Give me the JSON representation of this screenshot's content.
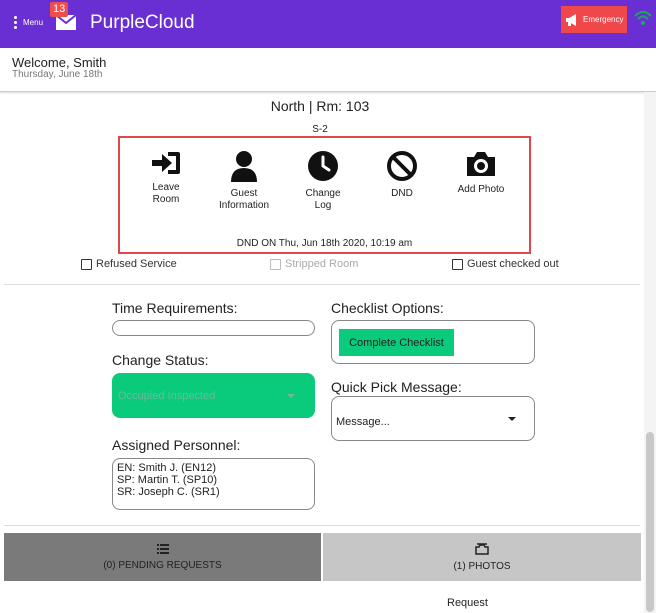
{
  "header": {
    "menu_label": "Menu",
    "mail_count": "13",
    "app_title": "PurpleCloud",
    "emergency_label": "Emergency"
  },
  "welcome": {
    "greeting": "Welcome, Smith",
    "date": "Thursday, June 18th"
  },
  "room": {
    "title": "North | Rm: 103",
    "section": "S-2"
  },
  "actions": [
    {
      "label": "Leave\nRoom",
      "icon": "sign-in-icon"
    },
    {
      "label": "Guest\nInformation",
      "icon": "user-icon"
    },
    {
      "label": "Change\nLog",
      "icon": "clock-icon"
    },
    {
      "label": "DND",
      "icon": "ban-icon"
    },
    {
      "label": "Add Photo",
      "icon": "camera-icon"
    }
  ],
  "dnd_status": "DND ON Thu, Jun 18th 2020, 10:19 am",
  "checks": {
    "refused": {
      "label": "Refused Service",
      "checked": false
    },
    "stripped": {
      "label": "Stripped Room",
      "checked": false,
      "disabled": true
    },
    "checked_out": {
      "label": "Guest checked out",
      "checked": false
    }
  },
  "form": {
    "time_requirements_label": "Time Requirements:",
    "change_status_label": "Change Status:",
    "status_value": "Occupied Inspected",
    "assigned_personnel_label": "Assigned Personnel:",
    "personnel": [
      "EN: Smith J. (EN12)",
      "SP: Martin T. (SP10)",
      "SR: Joseph C. (SR1)"
    ],
    "checklist_options_label": "Checklist Options:",
    "complete_checklist_label": "Complete Checklist",
    "quick_pick_label": "Quick Pick Message:",
    "message_placeholder": "Message..."
  },
  "tabs": {
    "pending": "(0) PENDING REQUESTS",
    "photos": "(1) PHOTOS"
  },
  "request_label": "Request",
  "colors": {
    "header_bg": "#6a2fd3",
    "emergency_bg": "#f0474a",
    "accent_green": "#0acb7c",
    "highlight_border": "#e0474c"
  }
}
